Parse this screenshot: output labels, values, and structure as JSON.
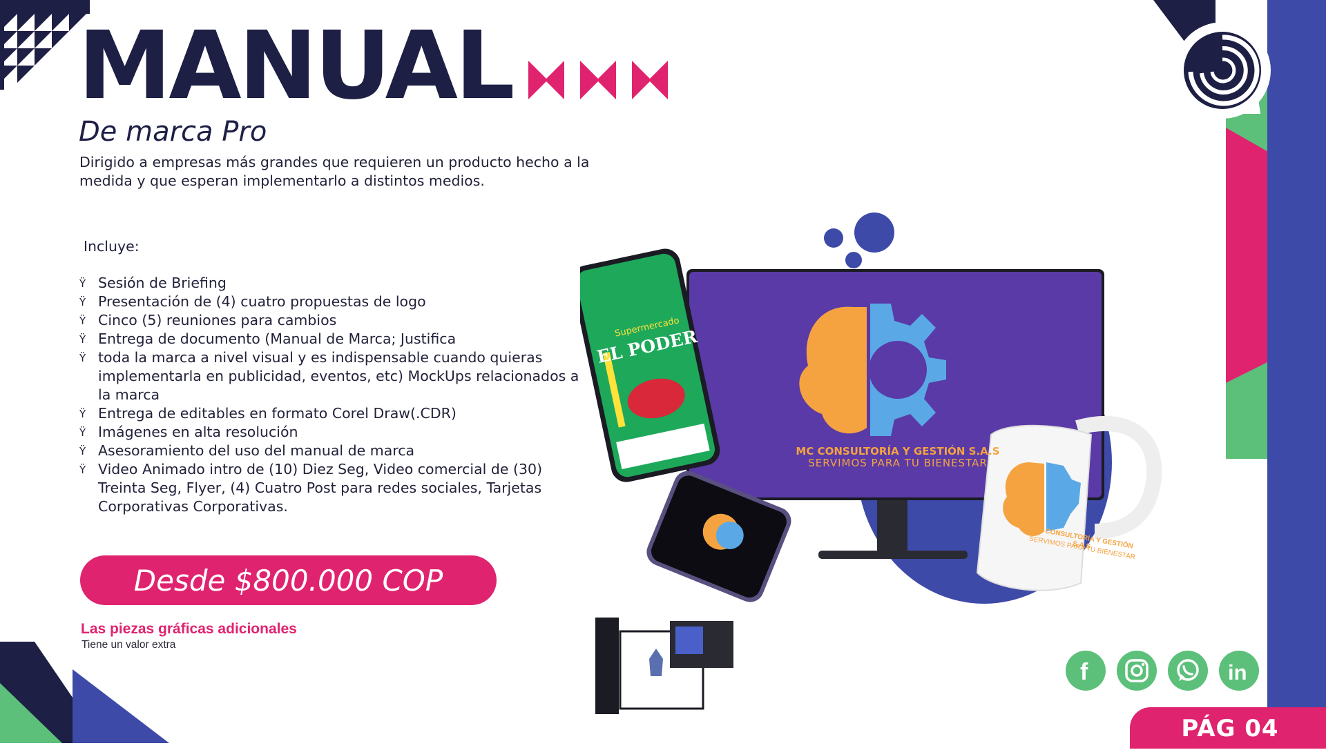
{
  "header": {
    "title": "MANUAL",
    "subtitle": "De marca Pro",
    "description": "Dirigido a empresas más grandes que requieren un producto hecho a la medida y que esperan implementarlo a distintos medios."
  },
  "includes": {
    "heading": "Incluye:",
    "bullet": "Ÿ",
    "items": [
      "Sesión de Briefing",
      "Presentación de (4) cuatro propuestas de logo",
      "Cinco (5) reuniones para cambios",
      "Entrega de documento (Manual de Marca; Justifica",
      "toda la marca a nivel visual y es indispensable cuando quieras implementarla en publicidad, eventos, etc) MockUps relacionados a la marca",
      "Entrega de editables en formato Corel Draw(.CDR)",
      "Imágenes en alta resolución",
      "Asesoramiento del uso del manual de marca",
      "Video Animado intro de (10) Diez Seg, Video comercial de (30) Treinta Seg, Flyer, (4) Cuatro Post para redes sociales, Tarjetas Corporativas Corporativas."
    ]
  },
  "price": {
    "label": "Desde $800.000 COP"
  },
  "note": {
    "title": "Las piezas gráficas adicionales",
    "subtitle": "Tiene un valor extra"
  },
  "mockup": {
    "screen_brand": "MC CONSULTORÍA Y GESTIÓN S.A.S",
    "screen_tagline": "SERVIMOS PARA TU BIENESTAR",
    "mug_brand": "MC CONSULTORÍA Y GESTIÓN S.A.S",
    "mug_tagline": "SERVIMOS PARA TU BIENESTAR",
    "phone_title": "Supermercado",
    "phone_headline": "EL PODER"
  },
  "social": {
    "icons": [
      "facebook-icon",
      "instagram-icon",
      "whatsapp-icon",
      "linkedin-icon"
    ]
  },
  "footer": {
    "page_number": "PÁG 04"
  },
  "colors": {
    "navy": "#1e1f45",
    "pink": "#e0236f",
    "green": "#5cc07a",
    "blue": "#3d4aa8",
    "purple": "#5a3aa6",
    "orange": "#f5a340",
    "light_blue": "#5aa9e6"
  }
}
